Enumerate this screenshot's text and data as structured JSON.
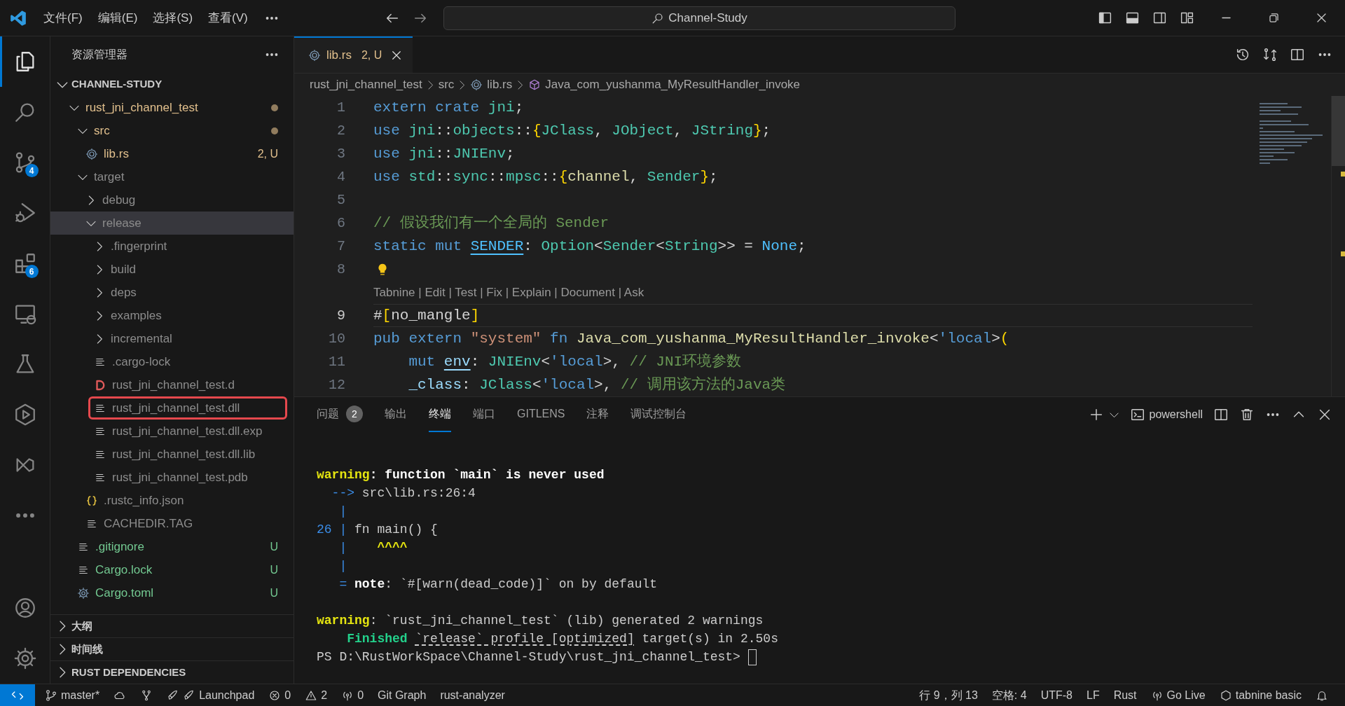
{
  "title_bar": {
    "menus": [
      "文件(F)",
      "编辑(E)",
      "选择(S)",
      "查看(V)"
    ],
    "search": "Channel-Study"
  },
  "activity_bar": {
    "top": [
      {
        "selected": true
      },
      {
        "selected": false
      },
      {
        "selected": false,
        "badge": "4"
      },
      {
        "selected": false
      },
      {
        "selected": false,
        "badge": "6"
      },
      {
        "selected": false
      },
      {
        "selected": false
      },
      {
        "selected": false
      },
      {
        "selected": false
      },
      {
        "selected": false
      }
    ],
    "bottom": [
      {
        "selected": false
      },
      {
        "selected": false
      }
    ]
  },
  "sidebar": {
    "title": "资源管理器",
    "root": {
      "label": "CHANNEL-STUDY",
      "expanded": true,
      "children": [
        {
          "label": "rust_jni_channel_test",
          "kind": "folder",
          "expanded": true,
          "selected": false,
          "boxed": false,
          "color": "#e2c08d",
          "dot": true,
          "children": [
            {
              "label": "src",
              "kind": "folder",
              "expanded": true,
              "selected": false,
              "boxed": false,
              "color": "#e2c08d",
              "dot": true,
              "children": [
                {
                  "label": "lib.rs",
                  "kind": "rust",
                  "selected": false,
                  "boxed": false,
                  "color": "#e2c08d",
                  "badge": "2, U"
                }
              ]
            },
            {
              "label": "target",
              "kind": "folder",
              "expanded": true,
              "selected": false,
              "boxed": false,
              "color": "#8c8c8c",
              "children": [
                {
                  "label": "debug",
                  "kind": "folder",
                  "expanded": false,
                  "selected": false,
                  "boxed": false,
                  "color": "#8c8c8c"
                },
                {
                  "label": "release",
                  "kind": "folder",
                  "expanded": true,
                  "selected": true,
                  "boxed": false,
                  "color": "#8c8c8c",
                  "children": [
                    {
                      "label": ".fingerprint",
                      "kind": "folder",
                      "expanded": false,
                      "selected": false,
                      "boxed": false,
                      "color": "#8c8c8c"
                    },
                    {
                      "label": "build",
                      "kind": "folder",
                      "expanded": false,
                      "selected": false,
                      "boxed": false,
                      "color": "#8c8c8c"
                    },
                    {
                      "label": "deps",
                      "kind": "folder",
                      "expanded": false,
                      "selected": false,
                      "boxed": false,
                      "color": "#8c8c8c"
                    },
                    {
                      "label": "examples",
                      "kind": "folder",
                      "expanded": false,
                      "selected": false,
                      "boxed": false,
                      "color": "#8c8c8c"
                    },
                    {
                      "label": "incremental",
                      "kind": "folder",
                      "expanded": false,
                      "selected": false,
                      "boxed": false,
                      "color": "#8c8c8c"
                    },
                    {
                      "label": ".cargo-lock",
                      "kind": "text",
                      "selected": false,
                      "boxed": false,
                      "color": "#8c8c8c"
                    },
                    {
                      "label": "rust_jni_channel_test.d",
                      "kind": "dep",
                      "selected": false,
                      "boxed": false,
                      "color": "#8c8c8c"
                    },
                    {
                      "label": "rust_jni_channel_test.dll",
                      "kind": "text",
                      "selected": false,
                      "boxed": true,
                      "color": "#8c8c8c"
                    },
                    {
                      "label": "rust_jni_channel_test.dll.exp",
                      "kind": "text",
                      "selected": false,
                      "boxed": false,
                      "color": "#8c8c8c"
                    },
                    {
                      "label": "rust_jni_channel_test.dll.lib",
                      "kind": "text",
                      "selected": false,
                      "boxed": false,
                      "color": "#8c8c8c"
                    },
                    {
                      "label": "rust_jni_channel_test.pdb",
                      "kind": "text",
                      "selected": false,
                      "boxed": false,
                      "color": "#8c8c8c"
                    }
                  ]
                },
                {
                  "label": ".rustc_info.json",
                  "kind": "json",
                  "selected": false,
                  "boxed": false,
                  "color": "#8c8c8c"
                },
                {
                  "label": "CACHEDIR.TAG",
                  "kind": "text",
                  "selected": false,
                  "boxed": false,
                  "color": "#8c8c8c"
                }
              ]
            },
            {
              "label": ".gitignore",
              "kind": "text",
              "selected": false,
              "boxed": false,
              "color": "#73c991",
              "badge": "U"
            },
            {
              "label": "Cargo.lock",
              "kind": "text",
              "selected": false,
              "boxed": false,
              "color": "#73c991",
              "badge": "U"
            },
            {
              "label": "Cargo.toml",
              "kind": "config",
              "selected": false,
              "boxed": false,
              "color": "#73c991",
              "badge": "U"
            }
          ]
        }
      ]
    },
    "sections": [
      {
        "label": "大纲",
        "expanded": false
      },
      {
        "label": "时间线",
        "expanded": false
      },
      {
        "label": "RUST DEPENDENCIES",
        "expanded": false
      }
    ]
  },
  "editor": {
    "tabs": [
      {
        "label": "lib.rs",
        "badge": "2, U",
        "selected": true
      }
    ],
    "breadcrumb": [
      "rust_jni_channel_test",
      "src",
      "lib.rs",
      "Java_com_yushanma_MyResultHandler_invoke"
    ],
    "lines": [
      {
        "kind": "code",
        "number": "1",
        "current": false,
        "tokens": [
          {
            "text": "extern crate ",
            "kind": "kw"
          },
          {
            "text": "jni",
            "kind": "type"
          },
          {
            "text": ";",
            "kind": "plain"
          }
        ]
      },
      {
        "kind": "code",
        "number": "2",
        "current": false,
        "tokens": [
          {
            "text": "use ",
            "kind": "kw"
          },
          {
            "text": "jni",
            "kind": "type"
          },
          {
            "text": "::",
            "kind": "plain"
          },
          {
            "text": "objects",
            "kind": "type"
          },
          {
            "text": "::",
            "kind": "plain"
          },
          {
            "text": "{",
            "kind": "brace"
          },
          {
            "text": "JClass",
            "kind": "type"
          },
          {
            "text": ", ",
            "kind": "plain"
          },
          {
            "text": "JObject",
            "kind": "type"
          },
          {
            "text": ", ",
            "kind": "plain"
          },
          {
            "text": "JString",
            "kind": "type"
          },
          {
            "text": "}",
            "kind": "brace"
          },
          {
            "text": ";",
            "kind": "plain"
          }
        ]
      },
      {
        "kind": "code",
        "number": "3",
        "current": false,
        "tokens": [
          {
            "text": "use ",
            "kind": "kw"
          },
          {
            "text": "jni",
            "kind": "type"
          },
          {
            "text": "::",
            "kind": "plain"
          },
          {
            "text": "JNIEnv",
            "kind": "type"
          },
          {
            "text": ";",
            "kind": "plain"
          }
        ]
      },
      {
        "kind": "code",
        "number": "4",
        "current": false,
        "tokens": [
          {
            "text": "use ",
            "kind": "kw"
          },
          {
            "text": "std",
            "kind": "type"
          },
          {
            "text": "::",
            "kind": "plain"
          },
          {
            "text": "sync",
            "kind": "type"
          },
          {
            "text": "::",
            "kind": "plain"
          },
          {
            "text": "mpsc",
            "kind": "type"
          },
          {
            "text": "::",
            "kind": "plain"
          },
          {
            "text": "{",
            "kind": "brace"
          },
          {
            "text": "channel",
            "kind": "fn"
          },
          {
            "text": ", ",
            "kind": "plain"
          },
          {
            "text": "Sender",
            "kind": "type"
          },
          {
            "text": "}",
            "kind": "brace"
          },
          {
            "text": ";",
            "kind": "plain"
          }
        ]
      },
      {
        "kind": "code",
        "number": "5",
        "current": false
      },
      {
        "kind": "code",
        "number": "6",
        "current": false,
        "tokens": [
          {
            "text": "// 假设我们有一个全局的 Sender",
            "kind": "comment"
          }
        ]
      },
      {
        "kind": "code",
        "number": "7",
        "current": false,
        "tokens": [
          {
            "text": "static mut ",
            "kind": "kw"
          },
          {
            "text": "SENDER",
            "kind": "const",
            "underlined": true
          },
          {
            "text": ": ",
            "kind": "plain"
          },
          {
            "text": "Option",
            "kind": "type"
          },
          {
            "text": "<",
            "kind": "plain"
          },
          {
            "text": "Sender",
            "kind": "type"
          },
          {
            "text": "<",
            "kind": "plain"
          },
          {
            "text": "String",
            "kind": "type"
          },
          {
            "text": ">> = ",
            "kind": "plain"
          },
          {
            "text": "None",
            "kind": "const"
          },
          {
            "text": ";",
            "kind": "plain"
          }
        ]
      },
      {
        "kind": "code",
        "number": "8",
        "current": false,
        "lightbulb": true
      },
      {
        "kind": "codelens",
        "text": "Tabnine | Edit | Test | Fix | Explain | Document | Ask"
      },
      {
        "kind": "code",
        "number": "9",
        "current": true,
        "tokens": [
          {
            "text": "#",
            "kind": "plain"
          },
          {
            "text": "[",
            "kind": "brace"
          },
          {
            "text": "no_mangle",
            "kind": "plain"
          },
          {
            "text": "]",
            "kind": "brace"
          }
        ]
      },
      {
        "kind": "code",
        "number": "10",
        "current": false,
        "tokens": [
          {
            "text": "pub extern ",
            "kind": "kw"
          },
          {
            "text": "\"system\"",
            "kind": "str"
          },
          {
            "text": " fn ",
            "kind": "kw"
          },
          {
            "text": "Java_com_yushanma_MyResultHandler_invoke",
            "kind": "fn"
          },
          {
            "text": "<",
            "kind": "plain"
          },
          {
            "text": "'local",
            "kind": "kw"
          },
          {
            "text": ">",
            "kind": "plain"
          },
          {
            "text": "(",
            "kind": "brace"
          }
        ]
      },
      {
        "kind": "code",
        "number": "11",
        "current": false,
        "tokens": [
          {
            "text": "    mut ",
            "kind": "kw"
          },
          {
            "text": "env",
            "kind": "var",
            "underlined": true
          },
          {
            "text": ": ",
            "kind": "plain"
          },
          {
            "text": "JNIEnv",
            "kind": "type"
          },
          {
            "text": "<",
            "kind": "plain"
          },
          {
            "text": "'local",
            "kind": "kw"
          },
          {
            "text": ">, ",
            "kind": "plain"
          },
          {
            "text": "// JNI环境参数",
            "kind": "comment"
          }
        ]
      },
      {
        "kind": "code",
        "number": "12",
        "current": false,
        "tokens": [
          {
            "text": "    _class",
            "kind": "var"
          },
          {
            "text": ": ",
            "kind": "plain"
          },
          {
            "text": "JClass",
            "kind": "type"
          },
          {
            "text": "<",
            "kind": "plain"
          },
          {
            "text": "'local",
            "kind": "kw"
          },
          {
            "text": ">, ",
            "kind": "plain"
          },
          {
            "text": "// 调用该方法的Java类",
            "kind": "comment"
          }
        ]
      }
    ]
  },
  "panel": {
    "tabs": [
      {
        "label": "问题",
        "badge": "2",
        "selected": false
      },
      {
        "label": "输出",
        "selected": false
      },
      {
        "label": "终端",
        "selected": true
      },
      {
        "label": "端口",
        "selected": false
      },
      {
        "label": "GITLENS",
        "selected": false
      },
      {
        "label": "注释",
        "selected": false
      },
      {
        "label": "调试控制台",
        "selected": false
      }
    ],
    "shell": "powershell",
    "terminal": [
      [
        {
          "segments": [
            {
              "text": "warning",
              "kind": "warn"
            },
            {
              "text": ": function `main` is never used",
              "kind": "bold"
            }
          ]
        },
        {
          "segments": [
            {
              "text": "  --> ",
              "kind": "blue"
            },
            {
              "text": "src\\lib.rs:26:4",
              "kind": "plain"
            }
          ]
        },
        {
          "segments": [
            {
              "text": "   |",
              "kind": "blue"
            }
          ]
        },
        {
          "segments": [
            {
              "text": "26 | ",
              "kind": "blue"
            },
            {
              "text": "fn main() {",
              "kind": "plain"
            }
          ]
        },
        {
          "segments": [
            {
              "text": "   | ",
              "kind": "blue"
            },
            {
              "text": "   ^^^^",
              "kind": "caret"
            }
          ]
        },
        {
          "segments": [
            {
              "text": "   |",
              "kind": "blue"
            }
          ]
        },
        {
          "segments": [
            {
              "text": "   = ",
              "kind": "blue"
            },
            {
              "text": "note",
              "kind": "bold"
            },
            {
              "text": ": `#[warn(dead_code)]` on by default",
              "kind": "plain"
            }
          ]
        }
      ],
      [
        {
          "segments": [
            {
              "text": "warning",
              "kind": "warn"
            },
            {
              "text": ": `rust_jni_channel_test` (lib) generated 2 warnings",
              "kind": "plain"
            }
          ]
        },
        {
          "segments": [
            {
              "text": "    Finished ",
              "kind": "green"
            },
            {
              "text": "`release` profile [optimized]",
              "kind": "link"
            },
            {
              "text": " target(s) in 2.50s",
              "kind": "plain"
            }
          ]
        },
        {
          "segments": [
            {
              "text": "PS D:\\RustWorkSpace\\Channel-Study\\rust_jni_channel_test> ",
              "kind": "plain"
            }
          ],
          "cursor": true
        }
      ]
    ]
  },
  "status_bar": {
    "left": [
      {
        "kind": "label",
        "text": "master*"
      },
      {
        "kind": "icon"
      },
      {
        "kind": "icon"
      },
      {
        "kind": "label",
        "text": "Launchpad"
      },
      {
        "kind": "label",
        "text": "0"
      },
      {
        "kind": "label",
        "text": "2"
      },
      {
        "kind": "label",
        "text": "0"
      },
      {
        "kind": "label",
        "text": "Git Graph"
      },
      {
        "kind": "label",
        "text": "rust-analyzer"
      }
    ],
    "right": [
      {
        "kind": "label",
        "text": "行 9，列 13"
      },
      {
        "kind": "label",
        "text": "空格: 4"
      },
      {
        "kind": "label",
        "text": "UTF-8"
      },
      {
        "kind": "label",
        "text": "LF"
      },
      {
        "kind": "label",
        "text": "Rust"
      },
      {
        "kind": "label",
        "text": "Go Live"
      },
      {
        "kind": "label",
        "text": "tabnine basic"
      },
      {
        "kind": "icon"
      }
    ]
  }
}
